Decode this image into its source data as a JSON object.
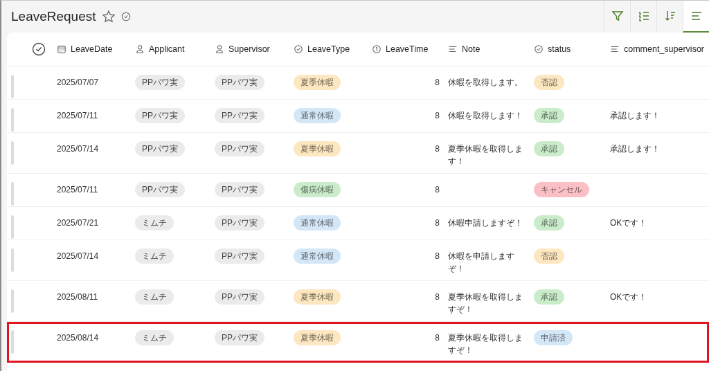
{
  "title": "LeaveRequest",
  "toolbar": [
    {
      "kind": "filter",
      "selected": false
    },
    {
      "kind": "list",
      "selected": false
    },
    {
      "kind": "sort",
      "selected": false
    },
    {
      "kind": "lines",
      "selected": true
    }
  ],
  "all_selected": false,
  "columns": [
    {
      "kind": "date",
      "label": "LeaveDate"
    },
    {
      "kind": "person",
      "label": "Applicant"
    },
    {
      "kind": "person",
      "label": "Supervisor"
    },
    {
      "kind": "choice",
      "label": "LeaveType"
    },
    {
      "kind": "number",
      "label": "LeaveTime"
    },
    {
      "kind": "text",
      "label": "Note"
    },
    {
      "kind": "choice",
      "label": "status"
    },
    {
      "kind": "text",
      "label": "comment_supervisor"
    }
  ],
  "rows": [
    {
      "highlighted": false,
      "date": "2025/07/07",
      "applicant": "PPパワ実",
      "supervisor": "PPパワ実",
      "leave_type": {
        "text": "夏季休暇",
        "color": "#fde7c1"
      },
      "time": "8",
      "note": "休暇を取得します。",
      "status": {
        "text": "否認",
        "color": "#fde7c1"
      },
      "comment": ""
    },
    {
      "highlighted": false,
      "date": "2025/07/11",
      "applicant": "PPパワ実",
      "supervisor": "PPパワ実",
      "leave_type": {
        "text": "通常休暇",
        "color": "#d4e7f7"
      },
      "time": "8",
      "note": "休暇を取得します！",
      "status": {
        "text": "承認",
        "color": "#caeccb"
      },
      "comment": "承認します！"
    },
    {
      "highlighted": false,
      "date": "2025/07/14",
      "applicant": "PPパワ実",
      "supervisor": "PPパワ実",
      "leave_type": {
        "text": "夏季休暇",
        "color": "#fde7c1"
      },
      "time": "8",
      "note": "夏季休暇を取得します！",
      "status": {
        "text": "承認",
        "color": "#caeccb"
      },
      "comment": "承認します！"
    },
    {
      "highlighted": false,
      "date": "2025/07/11",
      "applicant": "PPパワ実",
      "supervisor": "PPパワ実",
      "leave_type": {
        "text": "傷病休暇",
        "color": "#caeccb"
      },
      "time": "8",
      "note": "",
      "status": {
        "text": "キャンセル",
        "color": "#fbc0c6"
      },
      "comment": ""
    },
    {
      "highlighted": false,
      "date": "2025/07/21",
      "applicant": "ミムチ",
      "supervisor": "PPパワ実",
      "leave_type": {
        "text": "通常休暇",
        "color": "#d4e7f7"
      },
      "time": "8",
      "note": "休暇申請しますぞ！",
      "status": {
        "text": "承認",
        "color": "#caeccb"
      },
      "comment": "OKです！"
    },
    {
      "highlighted": false,
      "date": "2025/07/14",
      "applicant": "ミムチ",
      "supervisor": "PPパワ実",
      "leave_type": {
        "text": "通常休暇",
        "color": "#d4e7f7"
      },
      "time": "8",
      "note": "休暇を申請しますぞ！",
      "status": {
        "text": "否認",
        "color": "#fde7c1"
      },
      "comment": ""
    },
    {
      "highlighted": false,
      "date": "2025/08/11",
      "applicant": "ミムチ",
      "supervisor": "PPパワ実",
      "leave_type": {
        "text": "夏季休暇",
        "color": "#fde7c1"
      },
      "time": "8",
      "note": "夏季休暇を取得しますぞ！",
      "status": {
        "text": "承認",
        "color": "#caeccb"
      },
      "comment": "OKです！"
    },
    {
      "highlighted": true,
      "date": "2025/08/14",
      "applicant": "ミムチ",
      "supervisor": "PPパワ実",
      "leave_type": {
        "text": "夏季休暇",
        "color": "#fde7c1"
      },
      "time": "8",
      "note": "夏季休暇を取得しますぞ！",
      "status": {
        "text": "申請済",
        "color": "#d4e7f7"
      },
      "comment": ""
    }
  ]
}
